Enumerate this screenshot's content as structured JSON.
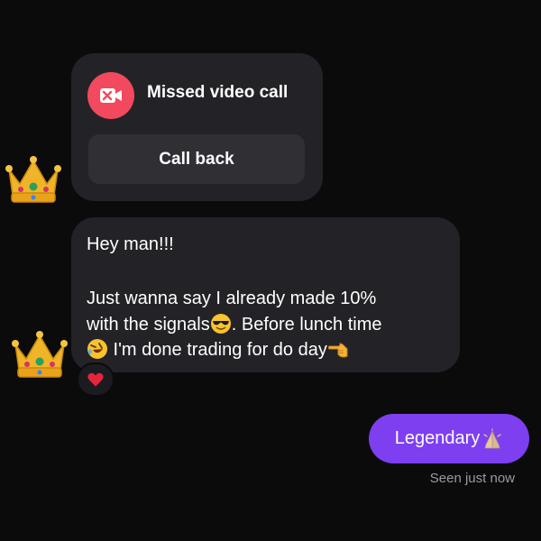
{
  "call_card": {
    "icon": "video-camera-off-icon",
    "title": "Missed video call",
    "call_back_label": "Call back",
    "icon_color": "#f2495e"
  },
  "message": {
    "line1": "Hey man!!!",
    "line2": "Just wanna say I already made 10%",
    "line3_before": "with the signals",
    "line3_emoji": "sunglasses-emoji",
    "line3_after": ". Before lunch time",
    "line4_emoji": "rofl-emoji",
    "line4_text": " I'm done trading for do day",
    "line4_end_emoji": "pointing-left-hand-emoji",
    "reaction": "red-heart-emoji"
  },
  "sent": {
    "text": "Legendary",
    "emoji": "folded-hands-emoji",
    "bubble_color": "#7d3ff0"
  },
  "status": {
    "seen": "Seen just now"
  },
  "avatars": [
    "crown-emoji",
    "crown-emoji"
  ]
}
